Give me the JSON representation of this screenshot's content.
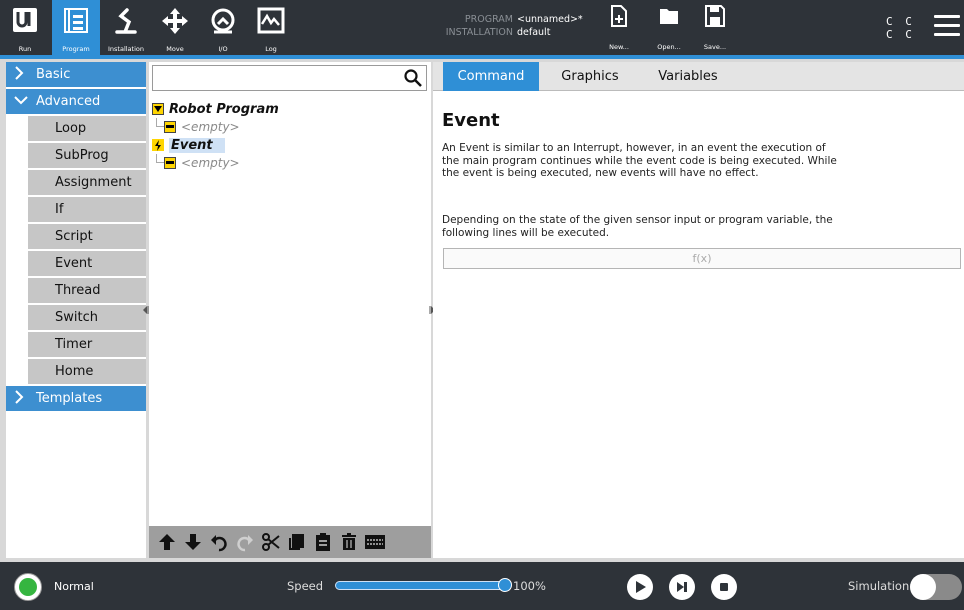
{
  "topbar": {
    "nav": [
      {
        "label": "Run",
        "icon": "ur-logo-icon"
      },
      {
        "label": "Program",
        "icon": "program-icon",
        "active": true
      },
      {
        "label": "Installation",
        "icon": "installation-icon"
      },
      {
        "label": "Move",
        "icon": "move-icon"
      },
      {
        "label": "I/O",
        "icon": "io-icon"
      },
      {
        "label": "Log",
        "icon": "log-icon"
      }
    ],
    "program_key": "PROGRAM",
    "program_value": "<unnamed>*",
    "installation_key": "INSTALLATION",
    "installation_value": "default",
    "new_label": "New...",
    "open_label": "Open...",
    "save_label": "Save...",
    "cc_line1": "C C",
    "cc_line2": "C C"
  },
  "leftnav": {
    "basic": "Basic",
    "advanced": "Advanced",
    "advanced_items": [
      "Loop",
      "SubProg",
      "Assignment",
      "If",
      "Script",
      "Event",
      "Thread",
      "Switch",
      "Timer",
      "Home"
    ],
    "templates": "Templates"
  },
  "tree": {
    "search_placeholder": "",
    "root": "Robot Program",
    "root_child": "<empty>",
    "event": "Event",
    "event_child": "<empty>"
  },
  "tabs": {
    "command": "Command",
    "graphics": "Graphics",
    "variables": "Variables"
  },
  "command": {
    "title": "Event",
    "desc1": "An Event is similar to an Interrupt, however, in an event the execution of the main program continues while the event code is being executed. While the event is being executed, new events will have no effect.",
    "desc2": "Depending on the state of the given sensor input or program variable, the following lines will be executed.",
    "expression": "f(x)"
  },
  "bottombar": {
    "status": "Normal",
    "speed_label": "Speed",
    "speed_value": "100%",
    "speed_fraction": 1.0,
    "simulation_label": "Simulation"
  },
  "colors": {
    "accent": "#2f8fd6",
    "topbar_bg": "#2e3339",
    "status_ok": "#35b540",
    "tree_tag": "#ffd500"
  }
}
